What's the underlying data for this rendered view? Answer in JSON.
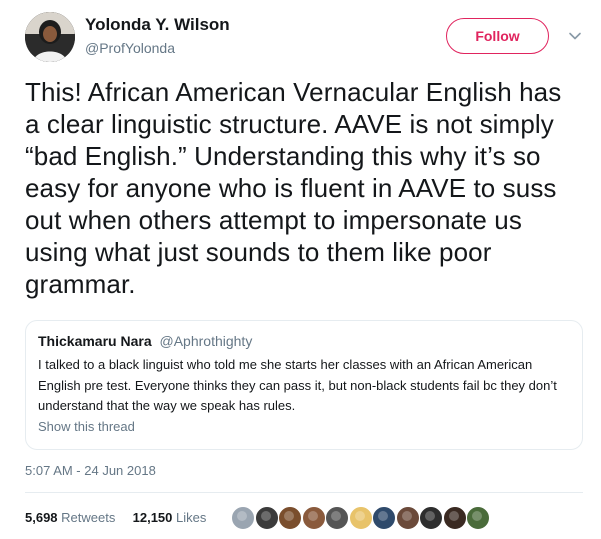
{
  "author": {
    "name": "Yolonda Y. Wilson",
    "handle": "@ProfYolonda"
  },
  "follow_label": "Follow",
  "tweet_text": "This! African American Vernacular English has\na clear linguistic structure. AAVE is not simply\n“bad English.” Understanding this why it’s so\neasy for anyone who is fluent in AAVE to suss\nout when others attempt to impersonate us\nusing what just sounds to them like poor\ngrammar.",
  "quoted_tweet": {
    "name": "Thickamaru Nara",
    "handle": "@Aphrothighty",
    "text": "I talked to a black linguist who told me she starts her classes with an African American English pre test. Everyone thinks they can pass it, but non-black students fail bc they don’t understand that the way we speak has rules.",
    "show_thread": "Show this thread"
  },
  "timestamp": "5:07 AM - 24 Jun 2018",
  "stats": {
    "retweets": "5,698",
    "retweets_label": "Retweets",
    "likes": "12,150",
    "likes_label": "Likes"
  },
  "liker_avatars": [
    {
      "color": "#9aa5b1",
      "icon": "default-avatar"
    },
    {
      "color": "#3b3b3b",
      "icon": "photo-avatar"
    },
    {
      "color": "#7a4e2d",
      "icon": "photo-avatar"
    },
    {
      "color": "#8a5a3c",
      "icon": "photo-avatar"
    },
    {
      "color": "#555555",
      "icon": "photo-avatar"
    },
    {
      "color": "#e8c36a",
      "icon": "photo-avatar"
    },
    {
      "color": "#2f4a6b",
      "icon": "photo-avatar"
    },
    {
      "color": "#6b4a3a",
      "icon": "photo-avatar"
    },
    {
      "color": "#2e2e2e",
      "icon": "photo-avatar"
    },
    {
      "color": "#3a2a22",
      "icon": "photo-avatar"
    },
    {
      "color": "#4a6b3a",
      "icon": "photo-avatar"
    }
  ],
  "colors": {
    "follow_accent": "#e0245e",
    "secondary_text": "#657786",
    "border": "#e6ecf0"
  }
}
